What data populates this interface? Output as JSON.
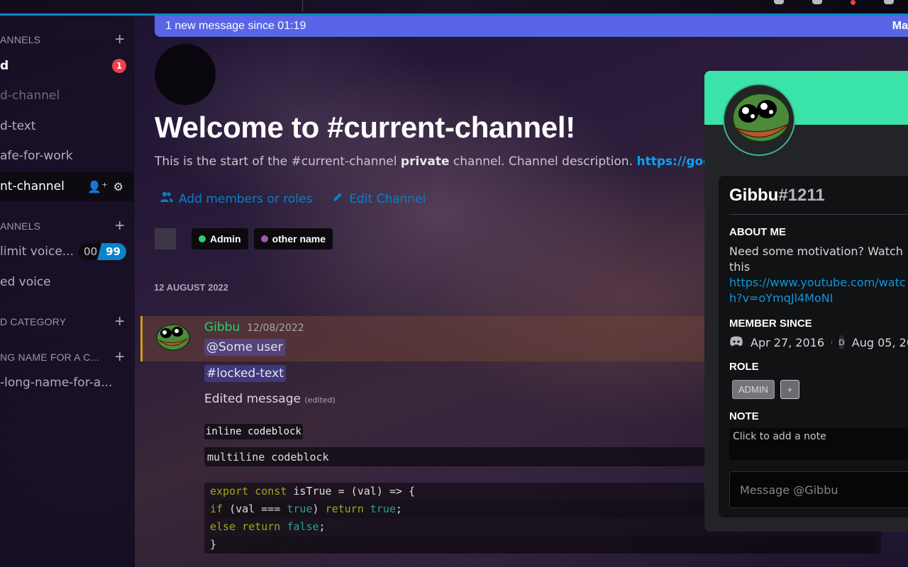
{
  "banner": {
    "text": "1 new message since 01:19",
    "right_label": "Ma",
    "color": "#5865e6"
  },
  "sidebar": {
    "categories": [
      {
        "label": "ANNELS",
        "add_icon": "plus-icon"
      },
      {
        "label": "ANNELS",
        "add_icon": "plus-icon"
      },
      {
        "label": "D CATEGORY",
        "add_icon": "plus-icon"
      },
      {
        "label": "NG NAME FOR A C...",
        "add_icon": "plus-icon"
      }
    ],
    "channels": [
      {
        "label": "d",
        "state": "unread",
        "badge": "1"
      },
      {
        "label": "d-channel",
        "state": "muted"
      },
      {
        "label": "d-text",
        "state": "normal"
      },
      {
        "label": "afe-for-work",
        "state": "normal"
      },
      {
        "label": "nt-channel",
        "state": "active",
        "icons": [
          "add-member-icon",
          "gear-icon"
        ]
      },
      {
        "label": "limit voice...",
        "state": "normal",
        "user_count": "00",
        "user_limit": "99"
      },
      {
        "label": "ed voice",
        "state": "normal"
      },
      {
        "label": "-long-name-for-a...",
        "state": "normal"
      }
    ]
  },
  "welcome": {
    "title": "Welcome to #current-channel!",
    "desc_prefix": "This is the start of the #current-channel ",
    "desc_bold": "private",
    "desc_mid": " channel. Channel description. ",
    "desc_link": "https://google.c",
    "actions": [
      {
        "label": "Add members or roles",
        "icon": "add-members-icon"
      },
      {
        "label": "Edit Channel",
        "icon": "pencil-icon"
      }
    ],
    "roles": [
      {
        "label": "Admin",
        "color": "#2ecc71"
      },
      {
        "label": "other name",
        "color": "#9b59b6"
      }
    ]
  },
  "messages": {
    "date_divider": "12 AUGUST 2022",
    "author": "Gibbu",
    "author_color": "#2ecc71",
    "timestamp": "12/08/2022",
    "mention": "@Some user",
    "channel_mention": "#locked-text",
    "edited_text": "Edited message",
    "edited_tag": "(edited)",
    "inline_code": "inline codeblock",
    "code_single": "multiline codeblock",
    "code_lines": [
      [
        {
          "t": "export",
          "c": "kw"
        },
        {
          "t": " "
        },
        {
          "t": "const",
          "c": "kw"
        },
        {
          "t": " isTrue = (val) => {"
        }
      ],
      [
        {
          "t": "if",
          "c": "kw"
        },
        {
          "t": " (val === "
        },
        {
          "t": "true",
          "c": "lit"
        },
        {
          "t": ") "
        },
        {
          "t": "return",
          "c": "kw"
        },
        {
          "t": " "
        },
        {
          "t": "true",
          "c": "lit"
        },
        {
          "t": ";"
        }
      ],
      [
        {
          "t": "else",
          "c": "kw"
        },
        {
          "t": " "
        },
        {
          "t": "return",
          "c": "kw"
        },
        {
          "t": " "
        },
        {
          "t": "false",
          "c": "lit"
        },
        {
          "t": ";"
        }
      ],
      [
        {
          "t": "}"
        }
      ]
    ]
  },
  "profile": {
    "banner_color": "#3ae3a8",
    "username": "Gibbu",
    "discriminator": "#1211",
    "about_heading": "ABOUT ME",
    "about_text": "Need some motivation? Watch this",
    "about_link": "https://www.youtube.com/watch?v=oYmqJl4MoNI",
    "member_since_heading": "MEMBER SINCE",
    "discord_since": "Apr 27, 2016",
    "server_initial": "D",
    "server_since": "Aug 05, 20",
    "role_heading": "ROLE",
    "roles": [
      "ADMIN"
    ],
    "add_role_label": "+",
    "note_heading": "NOTE",
    "note_placeholder": "Click to add a note",
    "message_placeholder": "Message @Gibbu"
  }
}
